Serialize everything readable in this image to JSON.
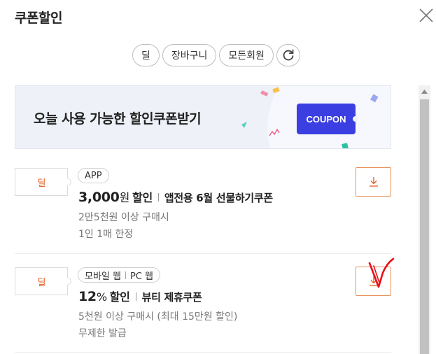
{
  "header": {
    "title": "쿠폰할인",
    "close_icon": "close-icon"
  },
  "filters": {
    "chips": [
      "딜",
      "장바구니",
      "모든회원"
    ],
    "refresh_icon": "refresh-icon"
  },
  "banner": {
    "text": "오늘 사용 가능한 할인쿠폰받기",
    "button_label": "COUPON",
    "accent": "#3b3ee0"
  },
  "coupons": [
    {
      "type_label": "딜",
      "tags": [
        "APP"
      ],
      "amount": "3,000",
      "unit": "원",
      "off_label": "할인",
      "name": "앱전용 6월 선물하기쿠폰",
      "condition1": "2만5천원 이상 구매시",
      "condition2": "1인 1매 한정",
      "download_icon": "download-icon"
    },
    {
      "type_label": "딜",
      "tags": [
        "모바일 웹",
        "PC 웹"
      ],
      "amount": "12",
      "unit": "%",
      "off_label": "할인",
      "name": "뷰티 제휴쿠폰",
      "condition1": "5천원 이상 구매시 (최대 15만원 할인)",
      "condition2": "무제한 발급",
      "download_icon": "download-icon"
    }
  ],
  "colors": {
    "deal_orange": "#e2571b",
    "download_border": "#e8925f",
    "annotation_red": "#e8101a"
  }
}
